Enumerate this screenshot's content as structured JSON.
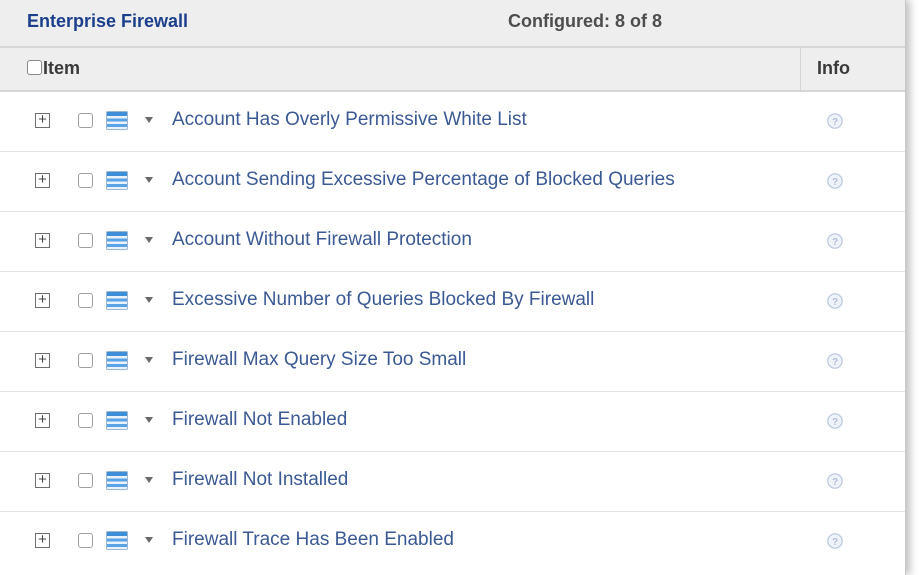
{
  "header": {
    "title": "Enterprise Firewall",
    "configured": "Configured: 8 of 8"
  },
  "columns": {
    "item": "Item",
    "info": "Info"
  },
  "expand_glyph": "+",
  "icons": {
    "expand": "plus-square-icon",
    "list": "list-icon",
    "dropdown": "caret-down-icon",
    "info": "question-circle-icon"
  },
  "colors": {
    "title": "#1c3f8c",
    "label": "#3b5a93",
    "list_icon": "#3f8fd8",
    "info_icon": "#b9c6dc"
  },
  "rows": [
    {
      "label": "Account Has Overly Permissive White List"
    },
    {
      "label": "Account Sending Excessive Percentage of Blocked Queries"
    },
    {
      "label": "Account Without Firewall Protection"
    },
    {
      "label": "Excessive Number of Queries Blocked By Firewall"
    },
    {
      "label": "Firewall Max Query Size Too Small"
    },
    {
      "label": "Firewall Not Enabled"
    },
    {
      "label": "Firewall Not Installed"
    },
    {
      "label": "Firewall Trace Has Been Enabled"
    }
  ]
}
